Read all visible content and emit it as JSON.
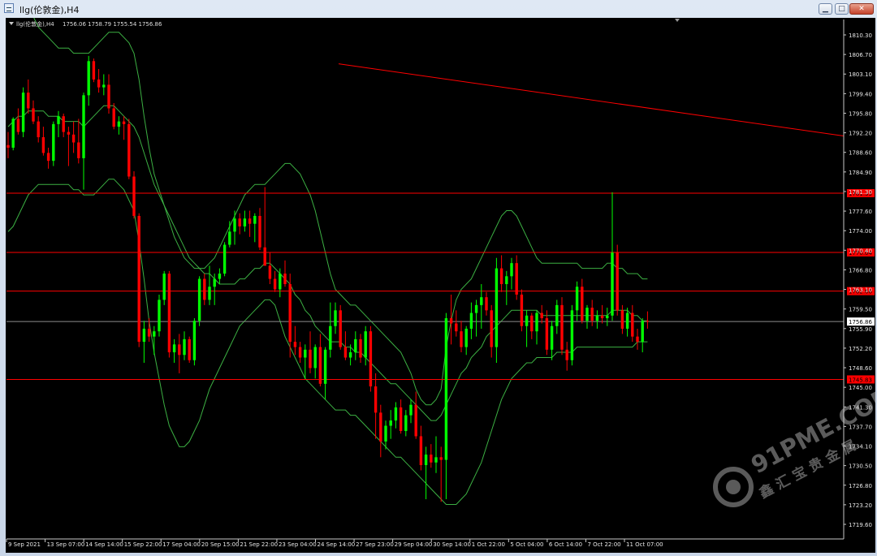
{
  "window": {
    "title": "llg(伦敦金),H4",
    "buttons": {
      "minimize": "▁",
      "maximize": "□",
      "close": "✕"
    }
  },
  "chart_header": {
    "symbol": "llg(伦敦金),H4",
    "ohlc": "1756.06 1758.79 1755.54 1756.86"
  },
  "price_axis": {
    "ticks": [
      "1810.30",
      "1806.70",
      "1803.10",
      "1799.40",
      "1795.80",
      "1792.20",
      "1788.60",
      "1784.90",
      "1781.30",
      "1777.60",
      "1774.00",
      "1770.40",
      "1766.80",
      "1763.10",
      "1759.50",
      "1755.90",
      "1752.20",
      "1748.60",
      "1745.00",
      "1741.30",
      "1737.70",
      "1734.10",
      "1730.50",
      "1726.80",
      "1723.20",
      "1719.60"
    ],
    "current_price_label": "1756.86",
    "level_labels": [
      "1781.33",
      "1770.04",
      "1762.66",
      "1745.83"
    ]
  },
  "time_axis": {
    "ticks": [
      "9 Sep 2021",
      "13 Sep 07:00",
      "14 Sep 14:00",
      "15 Sep 22:00",
      "17 Sep 04:00",
      "20 Sep 15:00",
      "21 Sep 22:00",
      "23 Sep 04:00",
      "24 Sep 14:00",
      "27 Sep 23:00",
      "29 Sep 04:00",
      "30 Sep 14:00",
      "1 Oct 22:00",
      "5 Oct 04:00",
      "6 Oct 14:00",
      "7 Oct 22:00",
      "11 Oct 07:00"
    ]
  },
  "watermark": {
    "brand": "91PME.COM",
    "subtitle": "鑫汇宝贵金属"
  },
  "colors": {
    "bull": "#00ff00",
    "bear": "#ff0000",
    "bands": "#3cb043",
    "levels": "#ff0000",
    "trendline": "#ff0000"
  },
  "chart_data": {
    "type": "candlestick",
    "symbol": "llg(伦敦金),H4",
    "ylim": [
      1719.6,
      1811.5
    ],
    "horizontal_levels": [
      1781.33,
      1770.04,
      1762.66,
      1745.83
    ],
    "current_price": 1756.86,
    "trendline": {
      "from": [
        0,
        1815.0
      ],
      "to": [
        164,
        1792.5
      ]
    },
    "candles": [
      [
        1790.5,
        1793.0,
        1788.0,
        1790.0
      ],
      [
        1790.0,
        1795.8,
        1789.5,
        1795.5
      ],
      [
        1795.5,
        1797.5,
        1792.5,
        1793.0
      ],
      [
        1793.0,
        1801.5,
        1792.0,
        1800.5
      ],
      [
        1800.5,
        1803.0,
        1796.5,
        1797.5
      ],
      [
        1797.5,
        1799.0,
        1794.5,
        1795.0
      ],
      [
        1795.0,
        1796.0,
        1791.0,
        1792.0
      ],
      [
        1792.0,
        1794.0,
        1788.5,
        1789.0
      ],
      [
        1789.0,
        1790.0,
        1786.0,
        1787.5
      ],
      [
        1787.5,
        1795.0,
        1786.5,
        1794.5
      ],
      [
        1794.5,
        1797.0,
        1792.0,
        1796.0
      ],
      [
        1796.0,
        1796.5,
        1792.0,
        1793.0
      ],
      [
        1793.0,
        1794.0,
        1786.5,
        1792.5
      ],
      [
        1792.5,
        1795.0,
        1789.0,
        1791.0
      ],
      [
        1791.0,
        1795.5,
        1787.0,
        1788.0
      ],
      [
        1788.0,
        1800.5,
        1782.0,
        1800.0
      ],
      [
        1800.0,
        1807.5,
        1798.0,
        1806.5
      ],
      [
        1806.5,
        1807.0,
        1802.5,
        1803.0
      ],
      [
        1803.0,
        1805.0,
        1800.5,
        1801.5
      ],
      [
        1801.5,
        1804.0,
        1800.0,
        1802.0
      ],
      [
        1802.0,
        1804.0,
        1796.5,
        1797.5
      ],
      [
        1797.5,
        1798.5,
        1793.5,
        1794.0
      ],
      [
        1794.0,
        1796.0,
        1792.5,
        1795.0
      ],
      [
        1795.0,
        1796.0,
        1791.5,
        1794.5
      ],
      [
        1794.5,
        1795.5,
        1784.0,
        1784.5
      ],
      [
        1784.5,
        1785.5,
        1776.5,
        1777.0
      ],
      [
        1777.0,
        1777.5,
        1752.0,
        1753.0
      ],
      [
        1753.0,
        1757.0,
        1749.0,
        1755.5
      ],
      [
        1755.5,
        1757.5,
        1753.0,
        1754.0
      ],
      [
        1754.0,
        1756.0,
        1750.5,
        1755.0
      ],
      [
        1755.0,
        1762.0,
        1754.0,
        1761.0
      ],
      [
        1761.0,
        1766.5,
        1760.0,
        1766.0
      ],
      [
        1766.0,
        1766.5,
        1750.0,
        1751.0
      ],
      [
        1751.0,
        1753.5,
        1749.0,
        1752.5
      ],
      [
        1752.5,
        1754.5,
        1747.0,
        1750.5
      ],
      [
        1750.5,
        1755.0,
        1749.5,
        1753.5
      ],
      [
        1753.5,
        1754.0,
        1749.0,
        1749.5
      ],
      [
        1749.5,
        1757.5,
        1748.5,
        1757.0
      ],
      [
        1757.0,
        1765.5,
        1756.0,
        1765.0
      ],
      [
        1765.0,
        1766.0,
        1760.0,
        1761.0
      ],
      [
        1761.0,
        1767.5,
        1760.0,
        1763.5
      ],
      [
        1763.5,
        1766.0,
        1760.0,
        1765.0
      ],
      [
        1765.0,
        1767.0,
        1764.0,
        1766.0
      ],
      [
        1766.0,
        1772.0,
        1765.5,
        1771.5
      ],
      [
        1771.5,
        1776.0,
        1771.0,
        1774.0
      ],
      [
        1774.0,
        1778.0,
        1771.5,
        1776.5
      ],
      [
        1776.5,
        1777.5,
        1773.5,
        1775.0
      ],
      [
        1775.0,
        1778.0,
        1774.0,
        1776.5
      ],
      [
        1776.5,
        1778.0,
        1773.0,
        1775.5
      ],
      [
        1775.5,
        1777.5,
        1772.0,
        1777.0
      ],
      [
        1777.0,
        1778.5,
        1770.5,
        1771.0
      ],
      [
        1771.0,
        1782.5,
        1767.5,
        1767.5
      ],
      [
        1767.5,
        1770.0,
        1764.0,
        1765.0
      ],
      [
        1765.0,
        1766.5,
        1762.5,
        1763.0
      ],
      [
        1763.0,
        1767.0,
        1761.5,
        1766.0
      ],
      [
        1766.0,
        1768.5,
        1763.5,
        1764.0
      ],
      [
        1764.0,
        1766.0,
        1750.0,
        1753.0
      ],
      [
        1753.0,
        1756.0,
        1750.5,
        1752.0
      ],
      [
        1752.0,
        1753.0,
        1749.0,
        1750.0
      ],
      [
        1750.0,
        1752.5,
        1746.0,
        1751.5
      ],
      [
        1751.5,
        1755.0,
        1747.0,
        1748.0
      ],
      [
        1748.0,
        1752.5,
        1746.0,
        1752.0
      ],
      [
        1752.0,
        1754.5,
        1744.5,
        1745.0
      ],
      [
        1745.0,
        1752.0,
        1742.0,
        1751.5
      ],
      [
        1751.5,
        1760.5,
        1750.0,
        1756.0
      ],
      [
        1756.0,
        1760.5,
        1754.5,
        1759.0
      ],
      [
        1759.0,
        1760.0,
        1751.5,
        1752.0
      ],
      [
        1752.0,
        1755.0,
        1749.5,
        1750.0
      ],
      [
        1750.0,
        1752.5,
        1748.5,
        1751.0
      ],
      [
        1751.0,
        1755.0,
        1749.5,
        1753.5
      ],
      [
        1753.5,
        1754.5,
        1749.0,
        1750.0
      ],
      [
        1750.0,
        1756.0,
        1748.5,
        1755.0
      ],
      [
        1755.0,
        1756.0,
        1743.5,
        1744.5
      ],
      [
        1744.5,
        1747.0,
        1734.5,
        1739.5
      ],
      [
        1739.5,
        1741.0,
        1731.0,
        1734.0
      ],
      [
        1734.0,
        1738.0,
        1732.5,
        1737.0
      ],
      [
        1737.0,
        1740.0,
        1734.5,
        1738.0
      ],
      [
        1738.0,
        1741.5,
        1736.5,
        1740.5
      ],
      [
        1740.5,
        1742.0,
        1735.5,
        1736.0
      ],
      [
        1736.0,
        1740.0,
        1735.0,
        1739.0
      ],
      [
        1739.0,
        1742.0,
        1737.5,
        1741.0
      ],
      [
        1741.0,
        1743.5,
        1734.5,
        1735.0
      ],
      [
        1735.0,
        1737.0,
        1728.5,
        1729.5
      ],
      [
        1729.5,
        1733.0,
        1723.0,
        1731.5
      ],
      [
        1731.5,
        1733.5,
        1729.0,
        1730.0
      ],
      [
        1730.0,
        1735.0,
        1728.0,
        1731.0
      ],
      [
        1731.0,
        1733.0,
        1722.5,
        1730.5
      ],
      [
        1730.5,
        1758.5,
        1723.0,
        1757.5
      ],
      [
        1757.5,
        1762.0,
        1752.5,
        1756.5
      ],
      [
        1756.5,
        1759.0,
        1754.0,
        1755.0
      ],
      [
        1755.0,
        1757.0,
        1751.0,
        1752.0
      ],
      [
        1752.0,
        1756.0,
        1750.5,
        1755.5
      ],
      [
        1755.5,
        1760.5,
        1753.5,
        1758.5
      ],
      [
        1758.5,
        1761.0,
        1754.0,
        1760.0
      ],
      [
        1760.0,
        1764.0,
        1755.5,
        1761.5
      ],
      [
        1761.5,
        1762.5,
        1758.0,
        1759.0
      ],
      [
        1759.0,
        1760.0,
        1750.0,
        1752.0
      ],
      [
        1752.0,
        1769.0,
        1749.0,
        1767.0
      ],
      [
        1767.0,
        1769.5,
        1762.5,
        1764.0
      ],
      [
        1764.0,
        1766.5,
        1760.0,
        1765.5
      ],
      [
        1765.5,
        1769.0,
        1763.0,
        1768.0
      ],
      [
        1768.0,
        1769.5,
        1761.0,
        1762.0
      ],
      [
        1762.0,
        1763.0,
        1755.0,
        1756.0
      ],
      [
        1756.0,
        1759.0,
        1752.0,
        1758.0
      ],
      [
        1758.0,
        1758.5,
        1753.5,
        1755.0
      ],
      [
        1755.0,
        1759.0,
        1752.5,
        1758.5
      ],
      [
        1758.5,
        1760.0,
        1756.5,
        1757.5
      ],
      [
        1757.5,
        1759.0,
        1750.5,
        1751.5
      ],
      [
        1751.5,
        1757.0,
        1749.5,
        1756.0
      ],
      [
        1756.0,
        1761.0,
        1754.5,
        1760.0
      ],
      [
        1760.0,
        1761.5,
        1750.5,
        1751.5
      ],
      [
        1751.5,
        1753.0,
        1747.5,
        1749.5
      ],
      [
        1749.5,
        1760.0,
        1748.5,
        1759.0
      ],
      [
        1759.0,
        1764.5,
        1757.0,
        1763.5
      ],
      [
        1763.5,
        1765.0,
        1756.5,
        1757.0
      ],
      [
        1757.0,
        1760.0,
        1755.5,
        1759.5
      ],
      [
        1759.5,
        1761.0,
        1756.0,
        1757.0
      ],
      [
        1757.0,
        1759.0,
        1755.5,
        1758.0
      ],
      [
        1758.0,
        1760.0,
        1756.5,
        1757.5
      ],
      [
        1757.5,
        1759.5,
        1756.0,
        1758.0
      ],
      [
        1758.0,
        1781.5,
        1757.0,
        1770.0
      ],
      [
        1770.0,
        1771.5,
        1758.0,
        1759.0
      ],
      [
        1759.0,
        1760.0,
        1754.5,
        1755.5
      ],
      [
        1755.5,
        1759.5,
        1754.0,
        1758.5
      ],
      [
        1758.5,
        1760.0,
        1753.0,
        1754.0
      ],
      [
        1754.0,
        1755.5,
        1751.5,
        1753.0
      ],
      [
        1753.0,
        1757.5,
        1751.0,
        1757.0
      ],
      [
        1757.0,
        1758.8,
        1755.5,
        1756.86
      ]
    ],
    "bollinger": {
      "upper": [
        1815,
        1817,
        1818,
        1818,
        1817,
        1815,
        1813,
        1812,
        1811,
        1810,
        1809,
        1809,
        1809,
        1808,
        1808,
        1808,
        1808,
        1809,
        1810,
        1811,
        1812,
        1812,
        1812,
        1811,
        1810,
        1808,
        1803,
        1796,
        1790,
        1785,
        1782,
        1779,
        1776,
        1773,
        1771,
        1769,
        1768,
        1767,
        1767,
        1767,
        1768,
        1769,
        1771,
        1773,
        1775,
        1777,
        1779,
        1781,
        1782,
        1783,
        1783,
        1783,
        1784,
        1785,
        1786,
        1787,
        1787,
        1786,
        1785,
        1783,
        1781,
        1778,
        1774,
        1770,
        1766,
        1763,
        1762,
        1761,
        1760,
        1760,
        1759,
        1758,
        1757,
        1756,
        1755,
        1754,
        1753,
        1752,
        1751,
        1749,
        1747,
        1744,
        1742,
        1741,
        1741,
        1742,
        1744,
        1752,
        1757,
        1761,
        1763,
        1764,
        1765,
        1767,
        1769,
        1771,
        1773,
        1775,
        1777,
        1778,
        1778,
        1777,
        1775,
        1773,
        1771,
        1769,
        1768,
        1768,
        1768,
        1768,
        1768,
        1768,
        1768,
        1768,
        1767,
        1767,
        1767,
        1767,
        1767,
        1768,
        1768,
        1767,
        1767,
        1766,
        1766,
        1766,
        1765,
        1765
      ],
      "middle": [
        1794,
        1795,
        1796,
        1796,
        1797,
        1797,
        1797,
        1797,
        1796,
        1796,
        1796,
        1795,
        1795,
        1795,
        1795,
        1794,
        1795,
        1796,
        1797,
        1798,
        1798,
        1798,
        1797,
        1796,
        1795,
        1794,
        1792,
        1789,
        1786,
        1783,
        1781,
        1779,
        1777,
        1775,
        1773,
        1771,
        1769,
        1768,
        1767,
        1766,
        1766,
        1765,
        1764,
        1764,
        1764,
        1764,
        1765,
        1765,
        1766,
        1767,
        1767,
        1768,
        1768,
        1767,
        1766,
        1765,
        1764,
        1762,
        1761,
        1759,
        1758,
        1756,
        1755,
        1754,
        1753,
        1753,
        1753,
        1752,
        1752,
        1751,
        1751,
        1750,
        1749,
        1748,
        1747,
        1746,
        1745,
        1745,
        1744,
        1743,
        1742,
        1741,
        1740,
        1739,
        1738,
        1738,
        1739,
        1741,
        1743,
        1745,
        1747,
        1748,
        1750,
        1751,
        1752,
        1754,
        1755,
        1756,
        1757,
        1758,
        1759,
        1759,
        1759,
        1759,
        1759,
        1759,
        1758,
        1758,
        1758,
        1758,
        1758,
        1758,
        1758,
        1758,
        1758,
        1758,
        1758,
        1758,
        1758,
        1758,
        1759,
        1759,
        1759,
        1759,
        1758,
        1758,
        1757,
        1757
      ],
      "lower": [
        1774,
        1775,
        1777,
        1779,
        1781,
        1782,
        1783,
        1783,
        1783,
        1783,
        1783,
        1783,
        1783,
        1782,
        1782,
        1781,
        1781,
        1781,
        1782,
        1783,
        1784,
        1784,
        1783,
        1782,
        1780,
        1778,
        1772,
        1765,
        1757,
        1751,
        1746,
        1741,
        1737,
        1735,
        1733,
        1733,
        1734,
        1736,
        1738,
        1741,
        1744,
        1746,
        1748,
        1750,
        1752,
        1754,
        1756,
        1757,
        1758,
        1759,
        1760,
        1761,
        1761,
        1760,
        1757,
        1754,
        1752,
        1750,
        1748,
        1746,
        1745,
        1744,
        1743,
        1742,
        1741,
        1740,
        1740,
        1740,
        1739,
        1739,
        1738,
        1737,
        1736,
        1735,
        1734,
        1733,
        1732,
        1731,
        1731,
        1730,
        1729,
        1728,
        1727,
        1726,
        1725,
        1724,
        1723,
        1722,
        1722,
        1722,
        1723,
        1724,
        1726,
        1728,
        1730,
        1733,
        1736,
        1739,
        1742,
        1744,
        1746,
        1747,
        1748,
        1749,
        1749,
        1750,
        1750,
        1750,
        1750,
        1751,
        1751,
        1751,
        1751,
        1752,
        1752,
        1752,
        1752,
        1752,
        1752,
        1752,
        1752,
        1752,
        1752,
        1752,
        1752,
        1753,
        1753,
        1753
      ]
    }
  }
}
